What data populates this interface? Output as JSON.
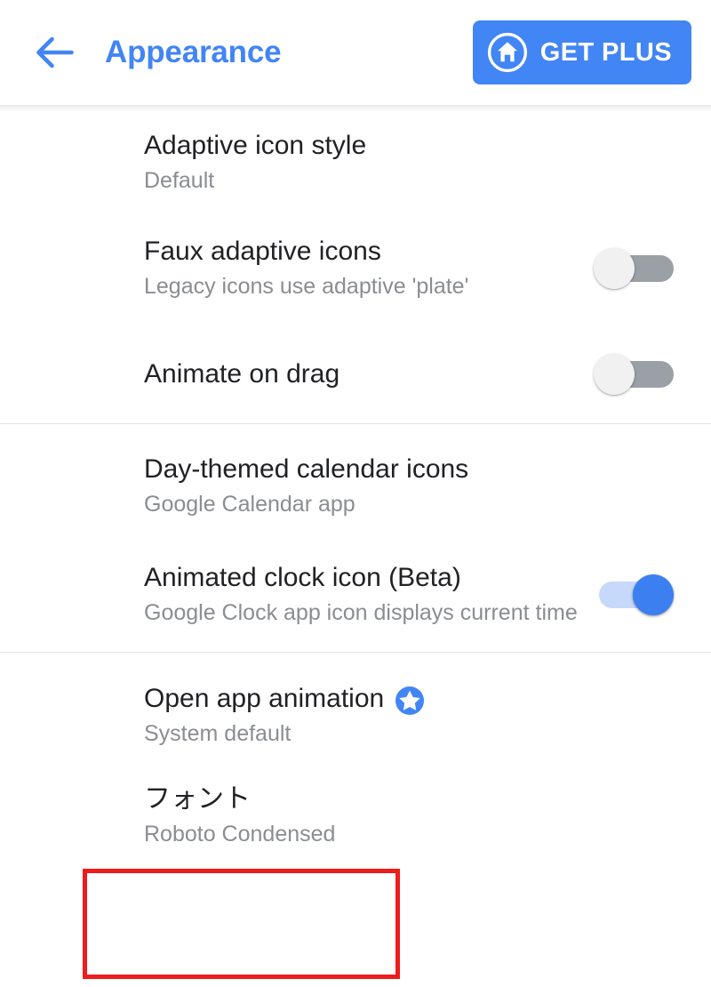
{
  "header": {
    "back_icon": "arrow-left-icon",
    "title": "Appearance",
    "cta": {
      "label": "GET PLUS",
      "icon": "home-circle-icon",
      "background": "#4285f4",
      "text_color": "#ffffff"
    },
    "title_color": "#4285f4"
  },
  "settings": {
    "sections": [
      {
        "rows": [
          {
            "title": "Adaptive icon style",
            "summary": "Default",
            "control": "none"
          },
          {
            "title": "Faux adaptive icons",
            "summary": "Legacy icons use adaptive 'plate'",
            "control": "switch",
            "switch_state": "off"
          },
          {
            "title": "Animate on drag",
            "summary": "",
            "control": "switch",
            "switch_state": "off"
          }
        ]
      },
      {
        "rows": [
          {
            "title": "Day-themed calendar icons",
            "summary": "Google Calendar app",
            "control": "none"
          },
          {
            "title": "Animated clock icon (Beta)",
            "summary": "Google Clock app icon displays current time",
            "control": "switch",
            "switch_state": "on"
          }
        ]
      },
      {
        "rows": [
          {
            "title": "Open app animation",
            "summary": "System default",
            "control": "none",
            "badge": "pro-star-icon"
          },
          {
            "title": "フォント",
            "summary": "Roboto Condensed",
            "control": "none",
            "highlighted": true
          }
        ]
      }
    ]
  },
  "annotation": {
    "type": "red-rectangle-highlight",
    "color": "#ee1c1c",
    "targets": "フォント"
  },
  "colors": {
    "accent": "#4285f4",
    "switch_on_knob": "#3b7ff0",
    "switch_on_track": "#c6d9fb",
    "switch_off_track": "#9aa0a6",
    "switch_off_knob": "#f1f1f1",
    "title_text": "#202124",
    "summary_text": "#8a8d91",
    "divider": "#e3e3e3",
    "annotation": "#ee1c1c"
  }
}
